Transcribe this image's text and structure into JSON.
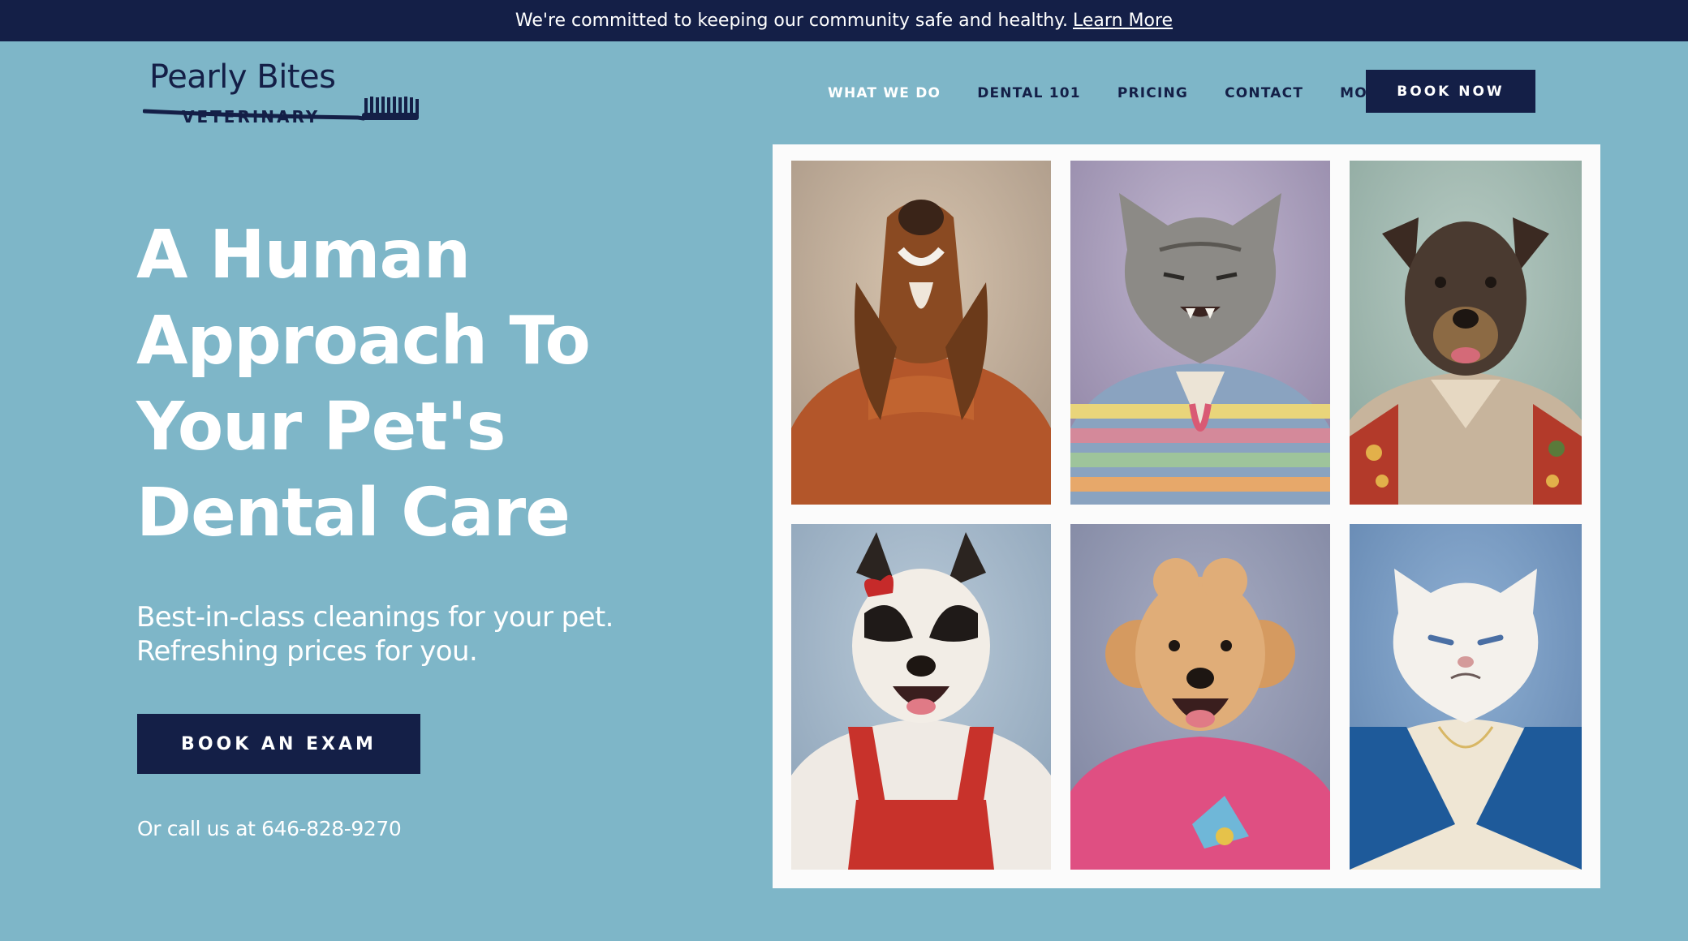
{
  "announcement": {
    "text": "We're committed to keeping our community safe and healthy.",
    "link": "Learn More"
  },
  "logo": {
    "name": "Pearly Bites",
    "sub": "VETERINARY"
  },
  "nav": {
    "items": [
      "WHAT WE DO",
      "DENTAL 101",
      "PRICING",
      "CONTACT",
      "MORE"
    ],
    "book_now": "BOOK NOW"
  },
  "hero": {
    "title_lines": [
      "A Human",
      "Approach To",
      "Your Pet's",
      "Dental Care"
    ],
    "subtitle_lines": [
      "Best-in-class cleanings for your pet.",
      "Refreshing prices for you."
    ],
    "cta": "BOOK AN EXAM",
    "call_text": "Or call us at 646-828-9270"
  },
  "gallery": {
    "photos": [
      {
        "subject": "dog-orange-turtleneck-icon"
      },
      {
        "subject": "cat-striped-sweater-icon"
      },
      {
        "subject": "terrier-floral-shirt-icon"
      },
      {
        "subject": "dog-red-overalls-icon"
      },
      {
        "subject": "poodle-pink-sweater-icon"
      },
      {
        "subject": "persian-cat-blue-dress-icon"
      }
    ]
  },
  "colors": {
    "background": "#7eb6c8",
    "navy": "#141f47",
    "white": "#ffffff"
  }
}
